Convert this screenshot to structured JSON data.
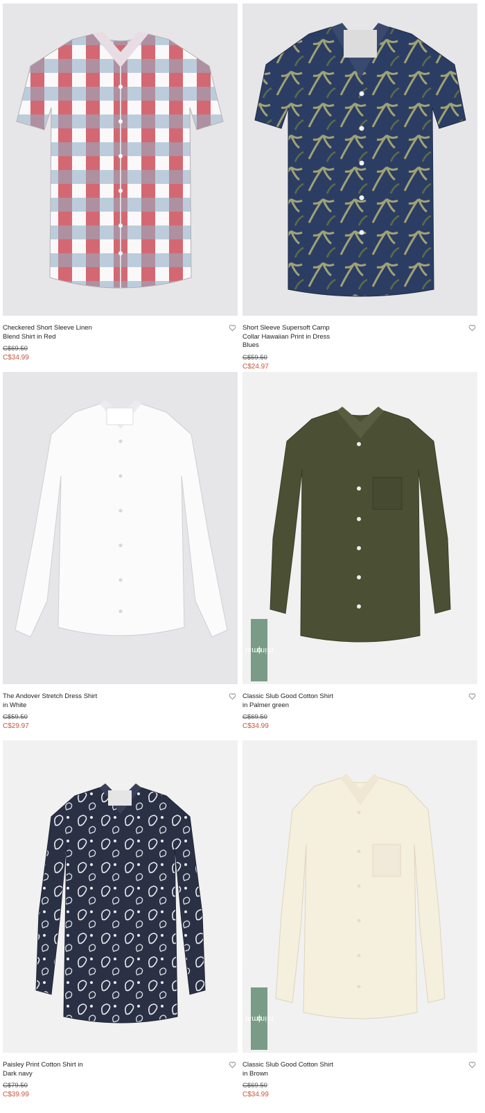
{
  "products": [
    {
      "title": "Checkered Short Sleeve Linen\nBlend Shirt in Red",
      "original_price": "C$69.50",
      "sale_price": "C$34.99",
      "badge": "",
      "shirt_style": "red-white-blue-check-short-sleeve",
      "bg": "#e6e6e8"
    },
    {
      "title": "Short Sleeve Supersoft Camp\nCollar Hawaiian Print in Dress\nBlues",
      "original_price": "C$59.50",
      "sale_price": "C$24.97",
      "badge": "",
      "shirt_style": "navy-palm-print-short-sleeve",
      "bg": "#e6e6e8"
    },
    {
      "title": "The Andover Stretch Dress Shirt\nin White",
      "original_price": "C$59.50",
      "sale_price": "C$29.97",
      "badge": "",
      "shirt_style": "white-long-sleeve",
      "bg": "#e6e6e8"
    },
    {
      "title": "Classic Slub Good Cotton Shirt\nin Palmer green",
      "original_price": "C$69.50",
      "sale_price": "C$34.99",
      "badge": "minimal",
      "shirt_style": "olive-long-sleeve",
      "bg": "#f1f1f1"
    },
    {
      "title": "Paisley Print Cotton Shirt in\nDark navy",
      "original_price": "C$79.50",
      "sale_price": "C$39.99",
      "badge": "",
      "shirt_style": "navy-paisley-long-sleeve",
      "bg": "#f1f1f1"
    },
    {
      "title": "Classic Slub Good Cotton Shirt\nin Brown",
      "original_price": "C$69.50",
      "sale_price": "C$34.99",
      "badge": "minimal",
      "shirt_style": "cream-long-sleeve",
      "bg": "#f1f1f1"
    }
  ],
  "colors": {
    "sale": "#c8553d",
    "badge": "#7a9c86"
  },
  "icons": {
    "wishlist": "heart-outline-icon",
    "badge": "leaf-icon"
  }
}
